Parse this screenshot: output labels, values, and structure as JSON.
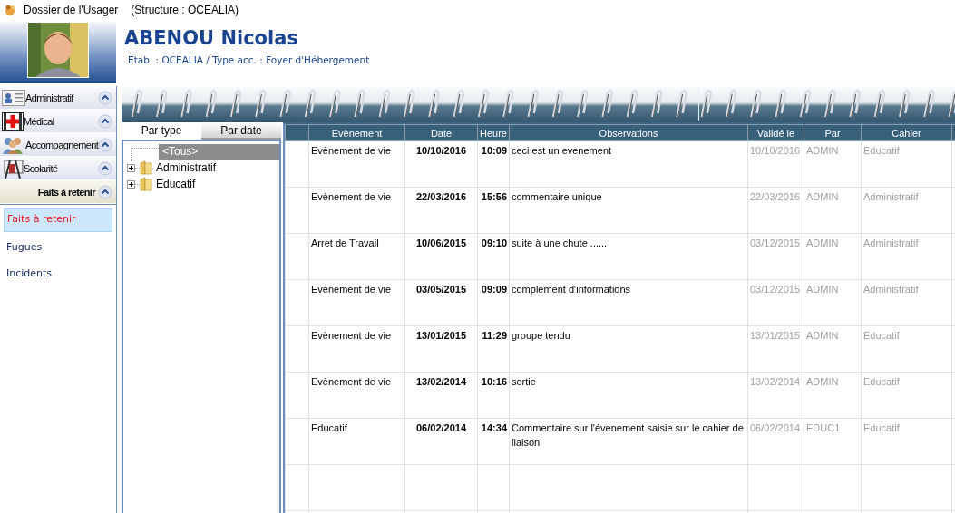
{
  "window": {
    "title": "Dossier de l'Usager",
    "subtitle": "(Structure : OCEALIA)"
  },
  "header": {
    "name": "ABENOU Nicolas",
    "details": "Etab. : OCEALIA / Type acc. : Foyer d'Hébergement"
  },
  "sidebar": {
    "sections": [
      {
        "label": "Administratif",
        "expanded": false
      },
      {
        "label": "Médical",
        "expanded": false
      },
      {
        "label": "Accompagnement",
        "expanded": false
      },
      {
        "label": "Scolarité",
        "expanded": false
      },
      {
        "label": "Faits à retenir",
        "expanded": true,
        "items": [
          {
            "label": "Faits à retenir",
            "selected": true
          },
          {
            "label": "Fugues",
            "selected": false
          },
          {
            "label": "Incidents",
            "selected": false
          }
        ]
      }
    ]
  },
  "tabs": [
    {
      "label": "Par type",
      "selected": true
    },
    {
      "label": "Par date",
      "selected": false
    }
  ],
  "tree": [
    {
      "label": "<Tous>",
      "selected": true
    },
    {
      "label": "Administratif",
      "selected": false,
      "expanded": false
    },
    {
      "label": "Educatif",
      "selected": false,
      "expanded": false
    }
  ],
  "table": {
    "columns": [
      "Evènement",
      "Date",
      "Heure",
      "Observations",
      "Validé le",
      "Par",
      "Cahier"
    ],
    "rows": [
      [
        "Evènement de vie",
        "10/10/2016",
        "10:09",
        "ceci est un evenement",
        "10/10/2016",
        "ADMIN",
        "Educatif"
      ],
      [
        "Evènement de vie",
        "22/03/2016",
        "15:56",
        "commentaire unique",
        "22/03/2016",
        "ADMIN",
        "Administratif"
      ],
      [
        "Arret de Travail",
        "10/06/2015",
        "09:10",
        "suite à une chute ......",
        "03/12/2015",
        "ADMIN",
        "Administratif"
      ],
      [
        "Evènement de vie",
        "03/05/2015",
        "09:09",
        "complément d'informations",
        "03/12/2015",
        "ADMIN",
        "Administratif"
      ],
      [
        "Evènement de vie",
        "13/01/2015",
        "11:29",
        "groupe tendu",
        "13/01/2015",
        "ADMIN",
        "Educatif"
      ],
      [
        "Evènement de vie",
        "13/02/2014",
        "10:16",
        "sortie",
        "13/02/2014",
        "ADMIN",
        "Educatif"
      ],
      [
        "Educatif",
        "06/02/2014",
        "14:34",
        "Commentaire sur l'évenement saisie sur le cahier de liaison",
        "06/02/2014",
        "EDUC1",
        "Educatif"
      ]
    ]
  }
}
